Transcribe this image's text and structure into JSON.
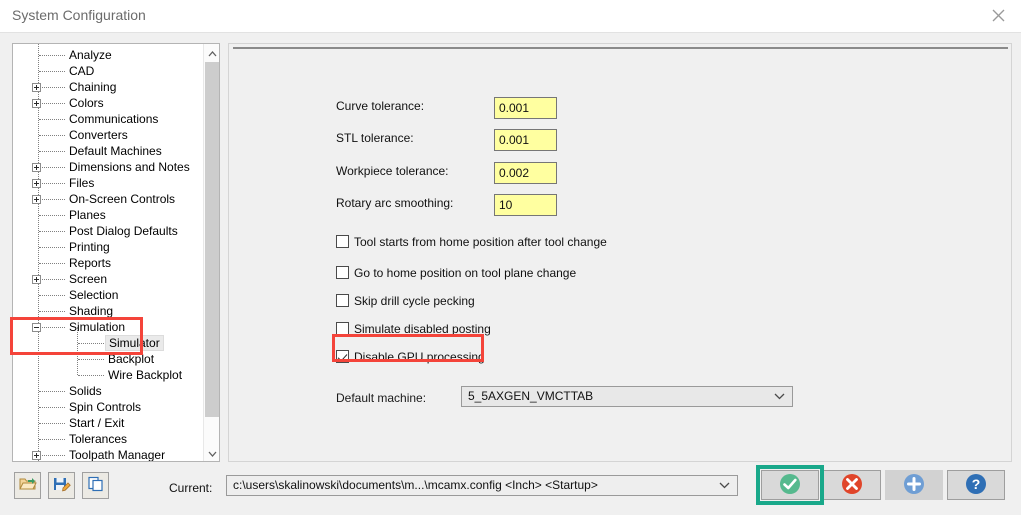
{
  "window": {
    "title": "System Configuration",
    "close_icon": "close-icon"
  },
  "tree": {
    "items": [
      {
        "label": "Analyze",
        "depth": 1,
        "expander": "none"
      },
      {
        "label": "CAD",
        "depth": 1,
        "expander": "none"
      },
      {
        "label": "Chaining",
        "depth": 1,
        "expander": "plus"
      },
      {
        "label": "Colors",
        "depth": 1,
        "expander": "plus"
      },
      {
        "label": "Communications",
        "depth": 1,
        "expander": "none"
      },
      {
        "label": "Converters",
        "depth": 1,
        "expander": "none"
      },
      {
        "label": "Default Machines",
        "depth": 1,
        "expander": "none"
      },
      {
        "label": "Dimensions and Notes",
        "depth": 1,
        "expander": "plus"
      },
      {
        "label": "Files",
        "depth": 1,
        "expander": "plus"
      },
      {
        "label": "On-Screen Controls",
        "depth": 1,
        "expander": "plus"
      },
      {
        "label": "Planes",
        "depth": 1,
        "expander": "none"
      },
      {
        "label": "Post Dialog Defaults",
        "depth": 1,
        "expander": "none"
      },
      {
        "label": "Printing",
        "depth": 1,
        "expander": "none"
      },
      {
        "label": "Reports",
        "depth": 1,
        "expander": "none"
      },
      {
        "label": "Screen",
        "depth": 1,
        "expander": "plus"
      },
      {
        "label": "Selection",
        "depth": 1,
        "expander": "none"
      },
      {
        "label": "Shading",
        "depth": 1,
        "expander": "none"
      },
      {
        "label": "Simulation",
        "depth": 1,
        "expander": "minus"
      },
      {
        "label": "Simulator",
        "depth": 2,
        "expander": "none",
        "selected": true
      },
      {
        "label": "Backplot",
        "depth": 2,
        "expander": "none"
      },
      {
        "label": "Wire Backplot",
        "depth": 2,
        "expander": "none"
      },
      {
        "label": "Solids",
        "depth": 1,
        "expander": "none"
      },
      {
        "label": "Spin Controls",
        "depth": 1,
        "expander": "none"
      },
      {
        "label": "Start / Exit",
        "depth": 1,
        "expander": "none"
      },
      {
        "label": "Tolerances",
        "depth": 1,
        "expander": "none"
      },
      {
        "label": "Toolpath Manager",
        "depth": 1,
        "expander": "plus"
      }
    ],
    "scrollbar": {
      "up_icon": "chevron-up-icon",
      "down_icon": "chevron-down-icon"
    }
  },
  "settings": {
    "fields": [
      {
        "label": "Curve tolerance:",
        "value": "0.001"
      },
      {
        "label": "STL tolerance:",
        "value": "0.001"
      },
      {
        "label": "Workpiece tolerance:",
        "value": "0.002"
      },
      {
        "label": "Rotary arc smoothing:",
        "value": "10"
      }
    ],
    "checkboxes": [
      {
        "label": "Tool starts from home position after tool change",
        "checked": false
      },
      {
        "label": "Go to home position on tool plane change",
        "checked": false
      },
      {
        "label": "Skip drill cycle pecking",
        "checked": false
      },
      {
        "label": "Simulate disabled posting",
        "checked": false
      },
      {
        "label": "Disable GPU processing",
        "checked": true
      }
    ],
    "machine": {
      "label": "Default machine:",
      "value": "5_5AXGEN_VMCTTAB",
      "caret_icon": "chevron-down-icon"
    }
  },
  "bottom": {
    "tools": [
      {
        "name": "open-config-button",
        "icon": "open-folder-icon"
      },
      {
        "name": "save-config-button",
        "icon": "save-edit-icon"
      },
      {
        "name": "copy-config-button",
        "icon": "copy-icon"
      }
    ],
    "current_label": "Current:",
    "current_value": "c:\\users\\skalinowski\\documents\\m...\\mcamx.config <Inch> <Startup>",
    "current_caret_icon": "chevron-down-icon",
    "actions": [
      {
        "name": "ok-button",
        "icon": "green-check-icon"
      },
      {
        "name": "cancel-button",
        "icon": "red-x-icon"
      },
      {
        "name": "add-button",
        "icon": "blue-plus-icon"
      },
      {
        "name": "help-button",
        "icon": "blue-question-icon"
      }
    ]
  },
  "annotations": {
    "highlight_color": "#f4443a",
    "focus_color": "#19a88a"
  }
}
